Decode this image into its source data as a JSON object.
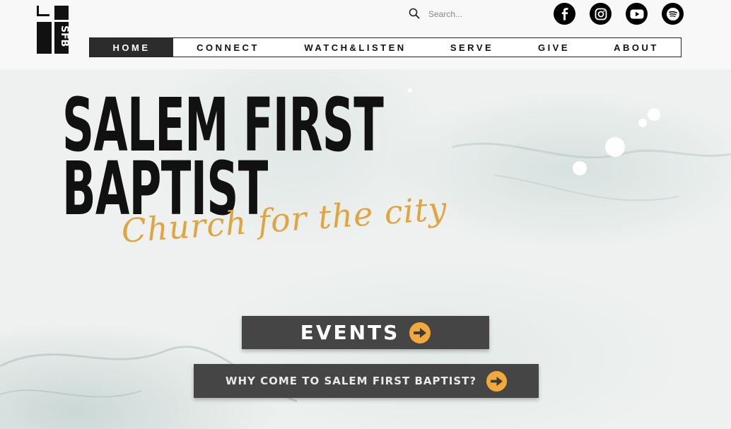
{
  "header": {
    "logo": {
      "icon": "sfb-logo-icon",
      "text": "SFB"
    },
    "search": {
      "placeholder": "Search...",
      "icon": "search-icon"
    },
    "social": [
      {
        "name": "facebook",
        "icon": "facebook-icon"
      },
      {
        "name": "instagram",
        "icon": "instagram-icon"
      },
      {
        "name": "youtube",
        "icon": "youtube-icon"
      },
      {
        "name": "spotify",
        "icon": "spotify-icon"
      }
    ]
  },
  "nav": {
    "items": [
      {
        "label": "HOME",
        "active": true
      },
      {
        "label": "CONNECT",
        "active": false
      },
      {
        "label": "WATCH&LISTEN",
        "active": false
      },
      {
        "label": "SERVE",
        "active": false
      },
      {
        "label": "GIVE",
        "active": false
      },
      {
        "label": "ABOUT",
        "active": false
      }
    ]
  },
  "hero": {
    "title_line1": "SALEM FIRST",
    "title_line2": "BAPTIST",
    "tagline": "Church for the city"
  },
  "buttons": {
    "events_label": "EVENTS",
    "why_label": "WHY COME TO SALEM FIRST BAPTIST?"
  },
  "colors": {
    "accent": "#f3a93a",
    "tagline": "#e0a53f",
    "button_bg": "#454545",
    "nav_active_bg": "#2c2c2c"
  }
}
